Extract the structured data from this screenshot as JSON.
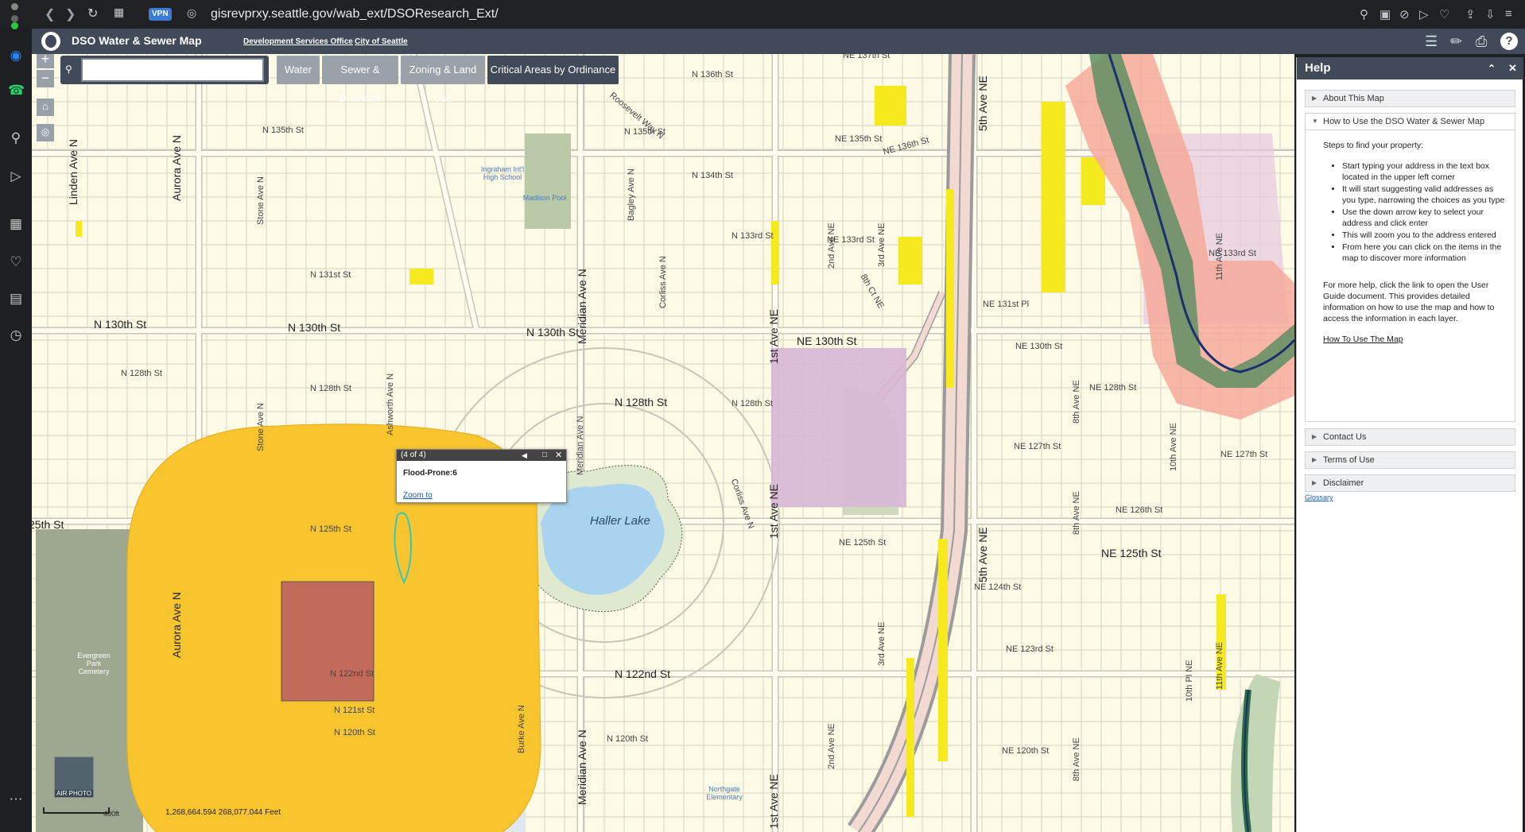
{
  "browser": {
    "url": "gisrevprxy.seattle.gov/wab_ext/DSOResearch_Ext/",
    "vpn_label": "VPN"
  },
  "app": {
    "title": "DSO Water & Sewer Map",
    "links": [
      "Development Services Office",
      "City of Seattle"
    ]
  },
  "toolbar": {
    "search_placeholder": "",
    "tabs": [
      "Water",
      "Sewer & Drainage",
      "Zoning & Land Use",
      "Critical Areas by Ordinance"
    ]
  },
  "map": {
    "streets": {
      "n136": "N 136th St",
      "n135": "N 135th St",
      "n135b": "N 135th St",
      "n134": "N 134th St",
      "n133": "N 133rd St",
      "ne133": "NE 133rd St",
      "ne133b": "NE 133rd St",
      "n131": "N 131st St",
      "n130a": "N 130th St",
      "n130b": "N 130th St",
      "n130c": "N 130th St",
      "ne130": "NE 130th St",
      "ne130b": "NE 130th St",
      "n128": "N 128th St",
      "n128b": "N 128th St",
      "n128c": "N 128th St",
      "n128d": "N 128th St",
      "ne128": "NE 128th St",
      "ne127": "NE 127th St",
      "ne127b": "NE 127th St",
      "ne126": "NE 126th St",
      "n125": "N 125th St",
      "st25": "25th St",
      "ne125": "NE 125th St",
      "ne125b": "NE 125th St",
      "ne124": "NE 124th St",
      "ne123": "NE 123rd St",
      "n122": "N 122nd St",
      "n122b": "N 122nd St",
      "n121": "N 121st St",
      "n120": "N 120th St",
      "n120b": "N 120th St",
      "ne120": "NE 120th St",
      "ne131pl": "NE 131st Pl",
      "ne135": "NE 135th St",
      "ne136": "NE 136th St",
      "ne137": "NE 137th St",
      "roosevelt": "Roosevelt Way N",
      "linden": "Linden Ave N",
      "aurora": "Aurora Ave N",
      "aurora2": "Aurora Ave N",
      "stone": "Stone Ave N",
      "stone2": "Stone Ave N",
      "meridian": "Meridian Ave N",
      "meridian2": "Meridian Ave N",
      "meridian3": "Meridian Ave N",
      "corliss": "Corliss Ave N",
      "corliss2": "Corliss Ave N",
      "ave1ne": "1st Ave NE",
      "ave1ne2": "1st Ave NE",
      "ave1ne3": "1st Ave NE",
      "ave5ne": "5th Ave NE",
      "ave5ne2": "5th Ave NE",
      "ave2ne": "2nd Ave NE",
      "ave2ne2": "2nd Ave NE",
      "ave3ne": "3rd Ave NE",
      "ave3ne2": "3rd Ave NE",
      "bagley": "Bagley Ave N",
      "burke": "Burke Ave N",
      "ashworth": "Ashworth Ave N",
      "ave8ne": "8th Ave NE",
      "ave8ne2": "8th Ave NE",
      "ave8ne3": "8th Ave NE",
      "ave10ne": "10th Ave NE",
      "ave11ne": "11th Ave NE",
      "ave11ne2": "11th Ave NE",
      "ave10pl": "10th Pl NE",
      "ave8ct": "8th Ct NE"
    },
    "places": {
      "haller_lake": "Haller Lake",
      "ingraham": "Ingraham Int'l High School",
      "madison_pool": "Madison Pool",
      "evergreen": "Evergreen Park Cemetery",
      "northgate": "Northgate Elementary"
    },
    "popup": {
      "counter": "(4 of 4)",
      "title": "Flood-Prone:6",
      "zoom_link": "Zoom to"
    },
    "coords": "1,268,664.594  268,077.044 Feet",
    "scale": "400ft",
    "air_photo_label": "AIR PHOTO"
  },
  "help": {
    "title": "Help",
    "sections": [
      "About This Map",
      "How to Use the DSO Water & Sewer Map",
      "Contact Us",
      "Terms of Use",
      "Disclaimer"
    ],
    "intro": "Steps to find your property:",
    "steps": [
      "Start typing your address in the text box located in the upper left corner",
      "It will start suggesting valid addresses as you type, narrowing the choices as you type",
      "Use the down arrow key to select your address and click enter",
      "This will zoom you to the address entered",
      "From here you can click on the items in the map to discover more information"
    ],
    "more": "For more help, click the link to open the User Guide document. This provides detailed information on how to use the map and how to access the information in each layer.",
    "link": "How To Use The Map",
    "glossary": "Glossary"
  }
}
